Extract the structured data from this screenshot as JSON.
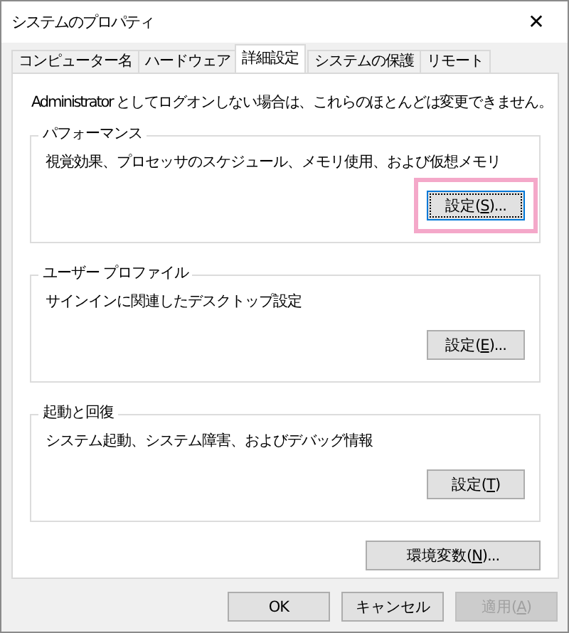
{
  "window": {
    "title": "システムのプロパティ",
    "close": "✕"
  },
  "tabs": [
    {
      "label": "コンピューター名",
      "selected": false
    },
    {
      "label": "ハードウェア",
      "selected": false
    },
    {
      "label": "詳細設定",
      "selected": true
    },
    {
      "label": "システムの保護",
      "selected": false
    },
    {
      "label": "リモート",
      "selected": false
    }
  ],
  "notice": "Administrator としてログオンしない場合は、これらのほとんどは変更できません。",
  "groups": [
    {
      "title": "パフォーマンス",
      "description": "視覚効果、プロセッサのスケジュール、メモリ使用、および仮想メモリ",
      "button": {
        "before": "設定(",
        "key": "S",
        "after": ")...",
        "focused": true,
        "highlighted": true
      }
    },
    {
      "title": "ユーザー プロファイル",
      "description": "サインインに関連したデスクトップ設定",
      "button": {
        "before": "設定(",
        "key": "E",
        "after": ")...",
        "focused": false,
        "highlighted": false
      }
    },
    {
      "title": "起動と回復",
      "description": "システム起動、システム障害、およびデバッグ情報",
      "button": {
        "before": "設定(",
        "key": "T",
        "after": ")",
        "focused": false,
        "highlighted": false
      }
    }
  ],
  "env_button": {
    "before": "環境変数(",
    "key": "N",
    "after": ")..."
  },
  "footer_buttons": [
    {
      "before": "OK",
      "disabled": false
    },
    {
      "before": "キャンセル",
      "disabled": false
    },
    {
      "before": "適用(",
      "key": "A",
      "after": ")",
      "disabled": true
    }
  ]
}
